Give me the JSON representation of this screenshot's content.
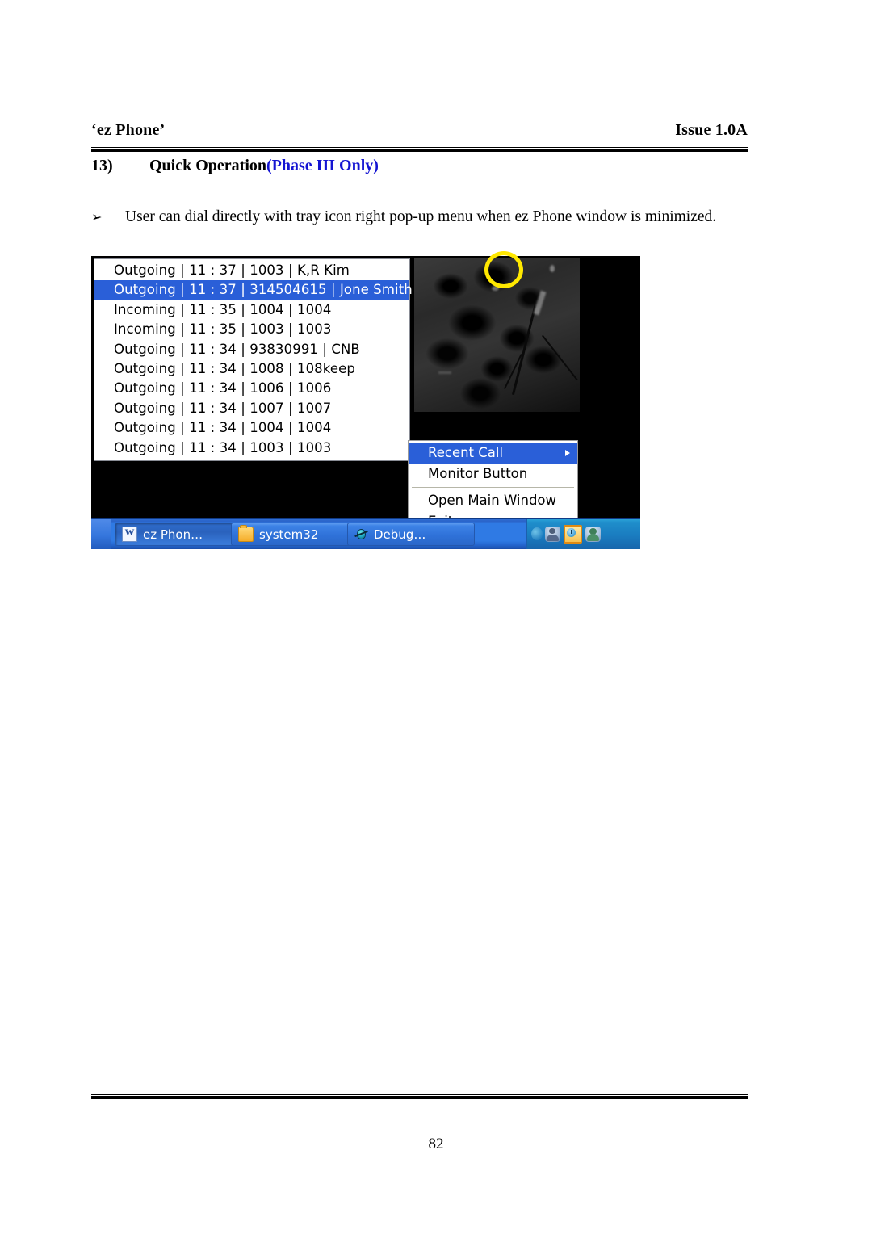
{
  "document": {
    "header_left": "‘ez Phone’",
    "header_right": "Issue 1.0A",
    "section_number": "13)",
    "section_title": "Quick Operation",
    "section_accent": "(Phase III Only)",
    "bullet_mark": "➢",
    "body_text": "User can dial directly with tray icon right pop-up menu when ez Phone window is minimized.",
    "page_number": "82",
    "accent_color": "#1414d2"
  },
  "screenshot": {
    "recent_call_list": {
      "rows": [
        {
          "text": "Outgoing |  11 : 37 |  1003 |  K,R Kim",
          "selected": false
        },
        {
          "text": "Outgoing |  11 : 37 |  314504615 |  Jone Smith",
          "selected": true
        },
        {
          "text": "Incoming |  11 : 35 |  1004 |  1004",
          "selected": false
        },
        {
          "text": "Incoming |  11 : 35 |  1003 |  1003",
          "selected": false
        },
        {
          "text": "Outgoing |  11 : 34 |  93830991 |  CNB",
          "selected": false
        },
        {
          "text": "Outgoing |  11 : 34 |  1008 |  108keep",
          "selected": false
        },
        {
          "text": "Outgoing |  11 : 34 |  1006 |  1006",
          "selected": false
        },
        {
          "text": "Outgoing |  11 : 34 |  1007 |  1007",
          "selected": false
        },
        {
          "text": "Outgoing |  11 : 34 |  1004 |  1004",
          "selected": false
        },
        {
          "text": "Outgoing |  11 : 34 |  1003 |  1003",
          "selected": false
        }
      ],
      "selection_color": "#2a5fd8"
    },
    "tray_menu": {
      "items": [
        {
          "label": "Recent Call",
          "selected": true,
          "submenu": true
        },
        {
          "label": "Monitor Button",
          "selected": false,
          "submenu": false
        },
        {
          "label": "Open Main Window",
          "selected": false,
          "submenu": false
        },
        {
          "label": "Exit",
          "selected": false,
          "submenu": false
        }
      ]
    },
    "taskbar": {
      "buttons": [
        {
          "label": "ez Phon…",
          "icon": "word-document-icon",
          "active": true
        },
        {
          "label": "system32",
          "icon": "folder-icon",
          "active": false
        },
        {
          "label": "Debug…",
          "icon": "bug-icon",
          "active": false
        }
      ],
      "tray_icons": [
        "network-person-icon",
        "ez-phone-tray-icon",
        "user-account-icon"
      ]
    },
    "annotation": {
      "shape": "circle",
      "color": "#ffe800",
      "target": "ez-phone-tray-icon"
    }
  }
}
